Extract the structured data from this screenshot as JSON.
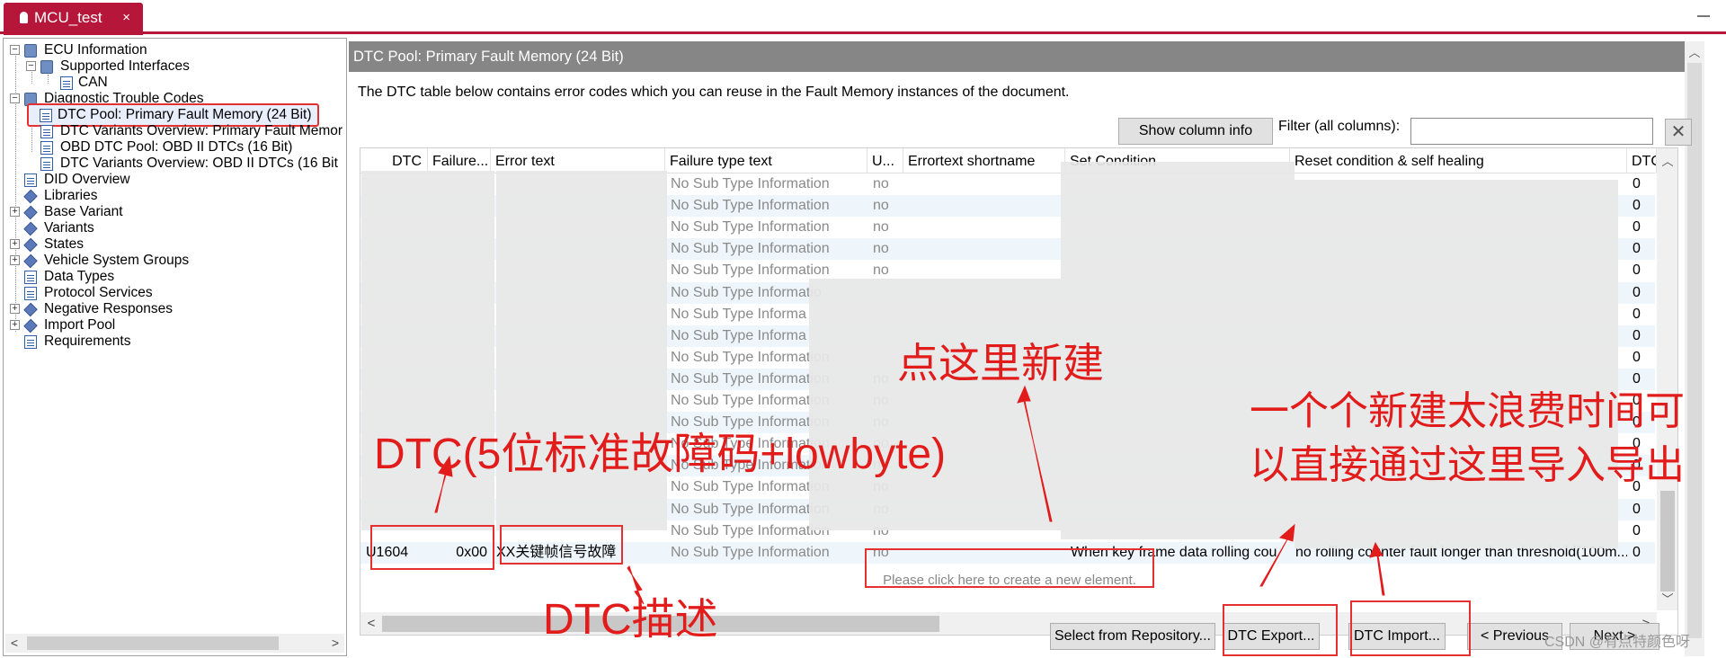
{
  "tab": {
    "title": "MCU_test",
    "close": "×"
  },
  "tree": {
    "items": [
      {
        "label": "ECU Information",
        "expander": "−",
        "icon": "book-icon"
      },
      {
        "label": "Supported Interfaces",
        "expander": "−",
        "icon": "book-icon"
      },
      {
        "label": "CAN",
        "icon": "document-icon"
      },
      {
        "label": "Diagnostic Trouble Codes",
        "expander": "−",
        "icon": "book-icon"
      },
      {
        "label": "DTC Pool: Primary Fault Memory (24 Bit)",
        "icon": "document-icon",
        "selected": true
      },
      {
        "label": "DTC Variants Overview: Primary Fault Memor",
        "icon": "document-icon"
      },
      {
        "label": "OBD DTC Pool: OBD II DTCs (16 Bit)",
        "icon": "document-icon"
      },
      {
        "label": "DTC Variants Overview: OBD II DTCs (16 Bit",
        "icon": "document-icon"
      },
      {
        "label": "DID Overview",
        "icon": "document-icon"
      },
      {
        "label": "Libraries",
        "icon": "diamond-icon"
      },
      {
        "label": "Base Variant",
        "expander": "+",
        "icon": "diamond-icon"
      },
      {
        "label": "Variants",
        "icon": "diamond-icon"
      },
      {
        "label": "States",
        "expander": "+",
        "icon": "diamond-icon"
      },
      {
        "label": "Vehicle System Groups",
        "expander": "+",
        "icon": "diamond-icon"
      },
      {
        "label": "Data Types",
        "icon": "document-icon"
      },
      {
        "label": "Protocol Services",
        "icon": "document-icon"
      },
      {
        "label": "Negative Responses",
        "expander": "+",
        "icon": "diamond-icon"
      },
      {
        "label": "Import Pool",
        "expander": "+",
        "icon": "diamond-icon"
      },
      {
        "label": "Requirements",
        "icon": "document-icon"
      }
    ]
  },
  "header": {
    "title": "DTC Pool: Primary Fault Memory (24 Bit)"
  },
  "description": "The DTC table below contains error codes which you can reuse in the Fault Memory instances of the document.",
  "toolbar": {
    "show_column_info": "Show column info",
    "filter_label": "Filter (all columns):",
    "filter_value": "",
    "clear": "✕"
  },
  "table": {
    "columns": [
      "DTC",
      "Failure...",
      "Error text",
      "Failure type text",
      "U...",
      "Errortext shortname",
      "Set Condition",
      "Reset condition & self healing",
      "DTC"
    ],
    "rows": [
      {
        "failure_type": "No Sub Type Information",
        "u": "no",
        "last": "0"
      },
      {
        "failure_type": "No Sub Type Information",
        "u": "no",
        "last": "0"
      },
      {
        "failure_type": "No Sub Type Information",
        "u": "no",
        "last": "0"
      },
      {
        "failure_type": "No Sub Type Information",
        "u": "no",
        "last": "0"
      },
      {
        "failure_type": "No Sub Type Information",
        "u": "no",
        "last": "0"
      },
      {
        "failure_type": "No Sub Type Informatio",
        "u": "",
        "last": "0"
      },
      {
        "failure_type": "No Sub Type Informa",
        "u": "",
        "last": "0"
      },
      {
        "failure_type": "No Sub Type Informa",
        "u": "",
        "last": "0"
      },
      {
        "failure_type": "No Sub Type Information",
        "u": "",
        "last": "0"
      },
      {
        "failure_type": "No Sub Type Information",
        "u": "no",
        "last": "0"
      },
      {
        "failure_type": "No Sub Type Information",
        "u": "no",
        "last": "0"
      },
      {
        "failure_type": "No Sub Type Information",
        "u": "no",
        "last": "0"
      },
      {
        "failure_type": "No Sub Type Information",
        "u": "no",
        "last": "0"
      },
      {
        "failure_type": "No Sub Type Information",
        "u": "no",
        "last": "0"
      },
      {
        "failure_type": "No Sub Type Information",
        "u": "no",
        "last": "0"
      },
      {
        "failure_type": "No Sub Type Information",
        "u": "no",
        "last": "0"
      },
      {
        "failure_type": "No Sub Type Information",
        "u": "no",
        "last": "0"
      },
      {
        "dtc": "U1604",
        "failure": "0x00",
        "error_text": "XX关键帧信号故障",
        "failure_type": "No Sub Type Information",
        "u": "no",
        "set_condition": "When key frame data rolling cou",
        "reset": "no rolling counter fault longer than threshold(100m...",
        "last": "0"
      }
    ],
    "new_element": "Please click here to create a new element."
  },
  "buttons": {
    "select_repo": "Select from Repository...",
    "dtc_export": "DTC Export...",
    "dtc_import": "DTC Import...",
    "previous": "< Previous",
    "next": "Next >"
  },
  "annotations": {
    "dtc_code": "DTC(5位标准故障码+lowbyte)",
    "click_new": "点这里新建",
    "bulk_line1": "一个个新建太浪费时间可",
    "bulk_line2": "以直接通过这里导入导出",
    "dtc_desc": "DTC描述",
    "color": "#e21b1b"
  },
  "watermark": "CSDN @有点特颜色呀"
}
